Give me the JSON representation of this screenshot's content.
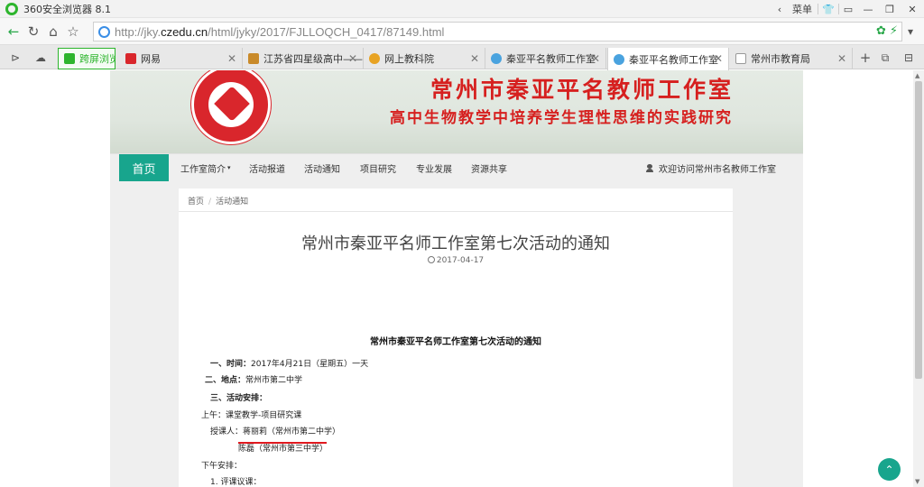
{
  "browser": {
    "window_title": "360安全浏览器 8.1",
    "menu_label": "菜单",
    "url_prefix": "http://jky.",
    "url_domain": "czedu.cn",
    "url_path": "/html/jyky/2017/FJLLOQCH_0417/87149.html",
    "tabs": [
      {
        "label": "跨屏浏览",
        "favicon_color": "#2db52d"
      },
      {
        "label": "网易",
        "favicon_color": "#d9262c"
      },
      {
        "label": "江苏省四星级高中——",
        "favicon_color": "#c98a2a"
      },
      {
        "label": "网上教科院",
        "favicon_color": "#e8a323"
      },
      {
        "label": "秦亚平名教师工作室",
        "favicon_color": "#4aa3df"
      },
      {
        "label": "秦亚平名教师工作室",
        "favicon_color": "#4aa3df",
        "active": true
      },
      {
        "label": "常州市教育局",
        "favicon_color": "#999999"
      }
    ]
  },
  "site": {
    "title": "常州市秦亚平名教师工作室",
    "subtitle": "高中生物教学中培养学生理性思维的实践研究",
    "emblem_text": "MINGSHIGONGZUOSHI",
    "nav": {
      "home": "首页",
      "items": [
        "工作室简介",
        "活动报道",
        "活动通知",
        "项目研究",
        "专业发展",
        "资源共享"
      ],
      "welcome": "欢迎访问常州市名教师工作室"
    }
  },
  "article": {
    "breadcrumb": [
      "首页",
      "活动通知"
    ],
    "title": "常州市秦亚平名师工作室第七次活动的通知",
    "date": "2017-04-17",
    "doc_title": "常州市秦亚平名师工作室第七次活动的通知",
    "lines": [
      {
        "label": "一、时间：",
        "text": "2017年4月21日（星期五）一天"
      },
      {
        "label": "二、地点：",
        "text": "常州市第二中学"
      },
      {
        "label": "三、活动安排：",
        "text": ""
      },
      {
        "label": "",
        "text": "上午：课堂教学-项目研究课"
      },
      {
        "label": "",
        "text": "授课人：蒋丽莉（常州市第二中学）"
      },
      {
        "label": "",
        "text": "陈磊（常州市第三中学）"
      },
      {
        "label": "",
        "text": "下午安排："
      },
      {
        "label": "",
        "text": "1. 评课议课："
      }
    ]
  },
  "colors": {
    "brand_green": "#18a58d",
    "banner_red": "#d6201f",
    "highlight_underline": "#e0191f"
  },
  "back_to_top_icon": "chevron-up-icon"
}
